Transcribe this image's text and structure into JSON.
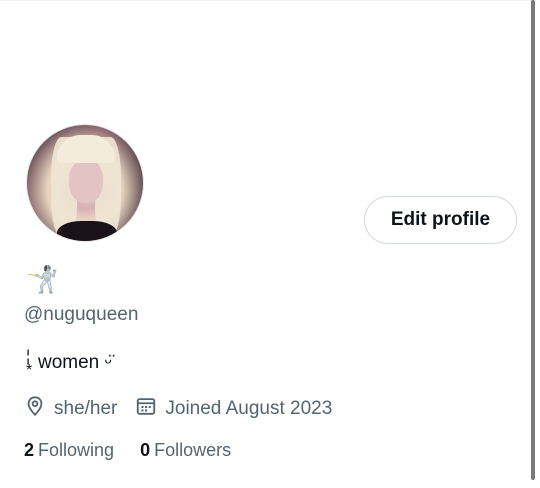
{
  "profile": {
    "display_name_emoji": "🤺",
    "handle": "@nuguqueen",
    "bio_marks": "¦\n*",
    "bio_text": "women ᵕ̈",
    "pronouns": "she/her",
    "joined": "Joined August 2023",
    "edit_button_label": "Edit profile"
  },
  "stats": {
    "following_count": "2",
    "following_label": "Following",
    "followers_count": "0",
    "followers_label": "Followers"
  },
  "icons": {
    "location": "location-pin-icon",
    "calendar": "calendar-icon"
  },
  "colors": {
    "text_primary": "#0f1419",
    "text_secondary": "#536471",
    "border": "#cfd9de"
  }
}
